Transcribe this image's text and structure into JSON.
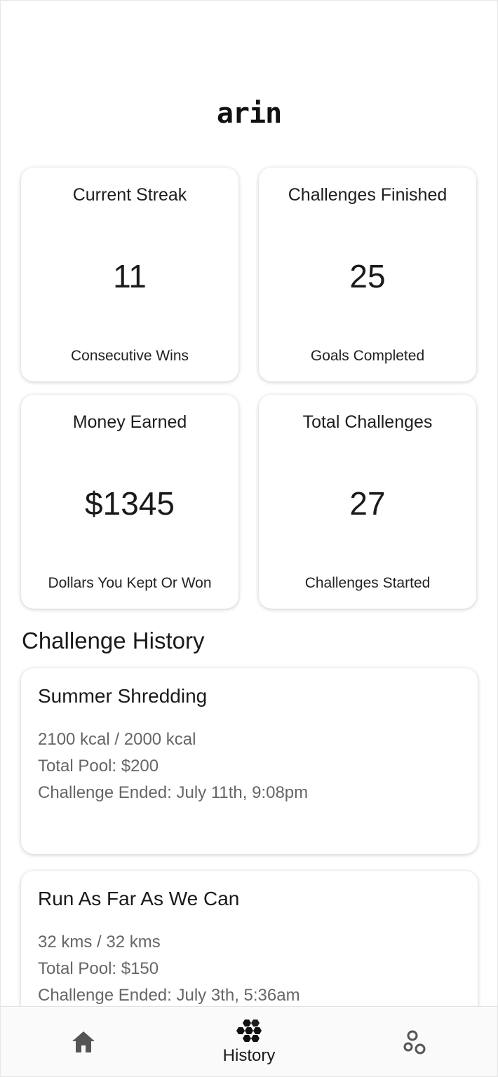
{
  "app": {
    "logo_text": "arin"
  },
  "stats": [
    {
      "title": "Current Streak",
      "value": "11",
      "subtitle": "Consecutive Wins"
    },
    {
      "title": "Challenges Finished",
      "value": "25",
      "subtitle": "Goals Completed"
    },
    {
      "title": "Money Earned",
      "value": "$1345",
      "subtitle": "Dollars You Kept Or Won"
    },
    {
      "title": "Total Challenges",
      "value": "27",
      "subtitle": "Challenges Started"
    }
  ],
  "history": {
    "heading": "Challenge History",
    "items": [
      {
        "title": "Summer Shredding",
        "progress": "2100 kcal / 2000 kcal",
        "pool": "Total Pool: $200",
        "ended": "Challenge Ended: July 11th, 9:08pm"
      },
      {
        "title": "Run As Far As We Can",
        "progress": "32 kms / 32 kms",
        "pool": "Total Pool: $150",
        "ended": "Challenge Ended: July 3th, 5:36am"
      }
    ]
  },
  "nav": {
    "home_icon": "home-icon",
    "history_icon": "hexagon-cluster-icon",
    "history_label": "History",
    "community_icon": "circles-icon",
    "icon_color": "#555555",
    "active_icon_color": "#111111"
  }
}
